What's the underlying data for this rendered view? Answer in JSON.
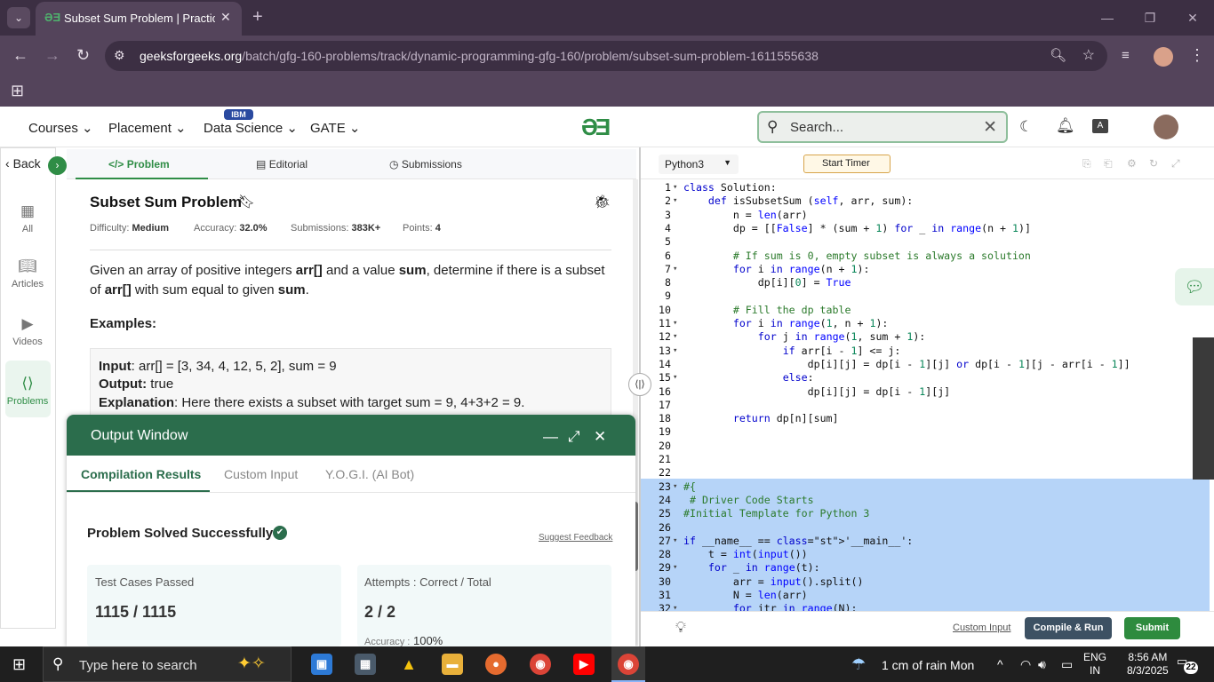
{
  "browser": {
    "tab_title": "Subset Sum Problem | Practice |",
    "url_domain": "geeksforgeeks.org",
    "url_path": "/batch/gfg-160-problems/track/dynamic-programming-gfg-160/problem/subset-sum-problem-1611555638"
  },
  "site_nav": {
    "items": [
      "Courses",
      "Placement",
      "Data Science",
      "GATE"
    ],
    "ibm_badge": "IBM",
    "search_placeholder": "Search..."
  },
  "rail": {
    "back": "Back",
    "items": [
      "All",
      "Articles",
      "Videos",
      "Problems"
    ]
  },
  "problem_tabs": [
    "Problem",
    "Editorial",
    "Submissions"
  ],
  "problem": {
    "title": "Subset Sum Problem",
    "difficulty_label": "Difficulty:",
    "difficulty": "Medium",
    "accuracy_label": "Accuracy:",
    "accuracy": "32.0%",
    "submissions_label": "Submissions:",
    "submissions": "383K+",
    "points_label": "Points:",
    "points": "4",
    "desc_1": "Given an array of positive integers ",
    "desc_arr": "arr[]",
    "desc_2": " and a value ",
    "desc_sum": "sum",
    "desc_3": ", determine if there is a subset of ",
    "desc_arr2": "arr[]",
    "desc_4": " with sum equal to given ",
    "desc_sum2": "sum",
    "desc_5": ".",
    "examples_heading": "Examples:",
    "input_label": "Input",
    "input_value": ": arr[] = [3, 34, 4, 12, 5, 2], sum = 9",
    "output_label": "Output:",
    "output_value": " true",
    "explanation_label": "Explanation",
    "explanation_value": ": Here there exists a subset with target sum = 9, 4+3+2 = 9."
  },
  "output_window": {
    "title": "Output Window",
    "tabs": [
      "Compilation Results",
      "Custom Input",
      "Y.O.G.I. (AI Bot)"
    ],
    "status": "Problem Solved Successfully",
    "feedback": "Suggest Feedback",
    "test_cases_label": "Test Cases Passed",
    "test_cases_value": "1115 / 1115",
    "attempts_label": "Attempts : Correct / Total",
    "attempts_value": "2 / 2",
    "accuracy_label": "Accuracy :",
    "accuracy_value": "100%"
  },
  "editor": {
    "language": "Python3",
    "timer_label": "Start Timer",
    "custom_input": "Custom Input",
    "compile_run": "Compile & Run",
    "submit": "Submit"
  },
  "code_lines": [
    "class Solution:",
    "    def isSubsetSum (self, arr, sum):",
    "        n = len(arr)",
    "        dp = [[False] * (sum + 1) for _ in range(n + 1)]",
    "",
    "        # If sum is 0, empty subset is always a solution",
    "        for i in range(n + 1):",
    "            dp[i][0] = True",
    "",
    "        # Fill the dp table",
    "        for i in range(1, n + 1):",
    "            for j in range(1, sum + 1):",
    "                if arr[i - 1] <= j:",
    "                    dp[i][j] = dp[i - 1][j] or dp[i - 1][j - arr[i - 1]]",
    "                else:",
    "                    dp[i][j] = dp[i - 1][j]",
    "",
    "        return dp[n][sum]",
    "",
    "",
    "",
    "",
    "#{",
    " # Driver Code Starts",
    "#Initial Template for Python 3",
    "",
    "if __name__ == '__main__':",
    "    t = int(input())",
    "    for _ in range(t):",
    "        arr = input().split()",
    "        N = len(arr)",
    "        for itr in range(N):"
  ],
  "fold_lines": [
    1,
    2,
    7,
    11,
    12,
    13,
    15,
    23,
    27,
    29,
    32
  ],
  "taskbar": {
    "search_placeholder": "Type here to search",
    "weather": "1 cm of rain Mon",
    "lang_1": "ENG",
    "lang_2": "IN",
    "time": "8:56 AM",
    "date": "8/3/2025",
    "notifications": "22"
  }
}
